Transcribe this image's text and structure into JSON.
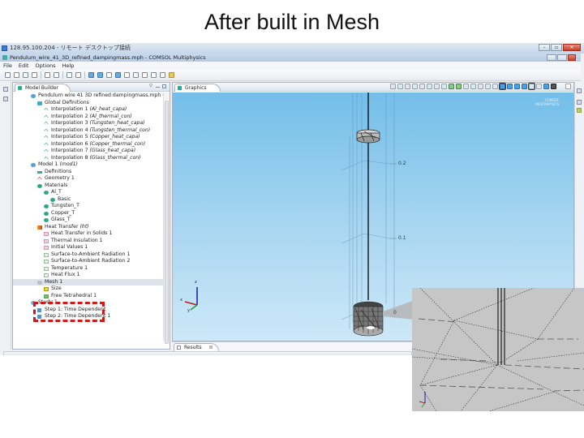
{
  "slide": {
    "title": "After built in Mesh"
  },
  "remote_desktop": {
    "title": "128.95.100.204 - リモート デスクトップ接続",
    "buttons": [
      "minimize",
      "restore",
      "close"
    ]
  },
  "app": {
    "title": "Pendulum_wire_41_3D_refined_dampingmass.mph - COMSOL Multiphysics",
    "menu": [
      "File",
      "Edit",
      "Options",
      "Help"
    ]
  },
  "model_builder": {
    "tab_label": "Model Builder",
    "tree": [
      {
        "level": 0,
        "icon": "global-icon",
        "label": "Pendulum wire 41 3D refined dampingmass.mph (root)",
        "italic_part": ""
      },
      {
        "level": 1,
        "icon": "global-defs-icon",
        "label": "Global Definitions"
      },
      {
        "level": 2,
        "icon": "interpolation-icon",
        "label": "Interpolation 1 ",
        "italic": "(Al_heat_capa)"
      },
      {
        "level": 2,
        "icon": "interpolation-icon",
        "label": "Interpolation 2 ",
        "italic": "(Al_thermal_con)"
      },
      {
        "level": 2,
        "icon": "interpolation-icon",
        "label": "Interpolation 3 ",
        "italic": "(Tungsten_heat_capa)"
      },
      {
        "level": 2,
        "icon": "interpolation-icon",
        "label": "Interpolation 4 ",
        "italic": "(Tungsten_thermal_con)"
      },
      {
        "level": 2,
        "icon": "interpolation-icon",
        "label": "Interpolation 5 ",
        "italic": "(Copper_heat_capa)"
      },
      {
        "level": 2,
        "icon": "interpolation-icon",
        "label": "Interpolation 6 ",
        "italic": "(Copper_thermal_con)"
      },
      {
        "level": 2,
        "icon": "interpolation-icon",
        "label": "Interpolation 7 ",
        "italic": "(Glass_heat_capa)"
      },
      {
        "level": 2,
        "icon": "interpolation-icon",
        "label": "Interpolation 8 ",
        "italic": "(Glass_thermal_con)"
      },
      {
        "level": 0,
        "icon": "model-icon",
        "label": "Model 1 ",
        "italic": "(mod1)"
      },
      {
        "level": 1,
        "icon": "definitions-icon",
        "label": "Definitions"
      },
      {
        "level": 1,
        "icon": "geometry-icon",
        "label": "Geometry 1"
      },
      {
        "level": 1,
        "icon": "materials-icon",
        "label": "Materials"
      },
      {
        "level": 2,
        "icon": "material-icon",
        "label": "Al_T"
      },
      {
        "level": 3,
        "icon": "material-icon",
        "label": "Basic"
      },
      {
        "level": 2,
        "icon": "material-icon",
        "label": "Tungsten_T"
      },
      {
        "level": 2,
        "icon": "material-icon",
        "label": "Copper_T"
      },
      {
        "level": 2,
        "icon": "material-icon",
        "label": "Glass_T"
      },
      {
        "level": 1,
        "icon": "heat-transfer-icon",
        "label": "Heat Transfer ",
        "italic": "(ht)"
      },
      {
        "level": 2,
        "icon": "feature-icon",
        "label": "Heat Transfer in Solids 1"
      },
      {
        "level": 2,
        "icon": "feature-icon",
        "label": "Thermal Insulation 1"
      },
      {
        "level": 2,
        "icon": "feature-icon",
        "label": "Initial Values 1"
      },
      {
        "level": 2,
        "icon": "feature2-icon",
        "label": "Surface-to-Ambient Radiation 1"
      },
      {
        "level": 2,
        "icon": "feature2-icon",
        "label": "Surface-to-Ambient Radiation 2"
      },
      {
        "level": 2,
        "icon": "feature2-icon",
        "label": "Temperature 1"
      },
      {
        "level": 2,
        "icon": "feature2-icon",
        "label": "Heat Flux 1"
      },
      {
        "level": 1,
        "icon": "mesh-icon",
        "label": "Mesh 1"
      },
      {
        "level": 2,
        "icon": "size-icon",
        "label": "Size"
      },
      {
        "level": 2,
        "icon": "free-tetrahedral-icon",
        "label": "Free Tetrahedral 1"
      },
      {
        "level": 0,
        "icon": "study-icon",
        "label": "Study 1"
      },
      {
        "level": 1,
        "icon": "study-step-icon",
        "label": "Step 1: Time Dependent"
      },
      {
        "level": 1,
        "icon": "study-step-icon",
        "label": "Step 2: Time Dependent 1"
      }
    ],
    "highlight": "Mesh 1"
  },
  "graphics": {
    "tab_label": "Graphics",
    "axis_labels": {
      "z": "z",
      "x": "x",
      "y": "y"
    },
    "tick_labels": [
      "0.2",
      "0.1",
      "0"
    ],
    "logo_text": [
      "COMSOL",
      "MULTIPHYSICS"
    ]
  },
  "results": {
    "tab_label": "Results"
  },
  "colors": {
    "viewport_top": "#73bee9",
    "viewport_bottom": "#cde8f8",
    "highlight_box": "#d01a1a",
    "inset_bg": "#c6c6c6"
  }
}
